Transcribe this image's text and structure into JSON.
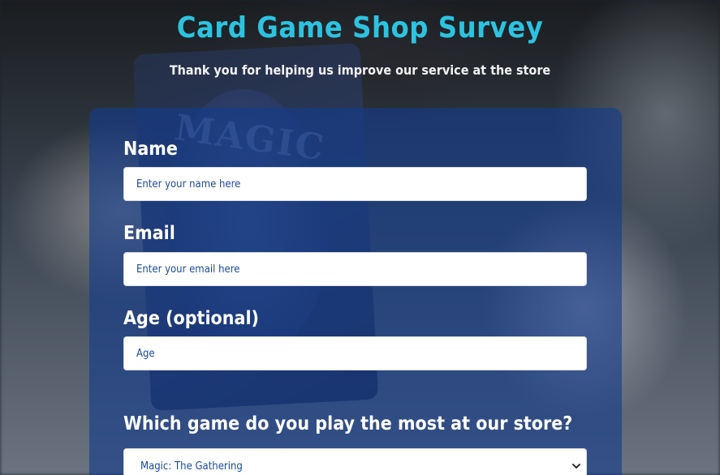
{
  "header": {
    "title": "Card Game Shop Survey",
    "subtitle": "Thank you for helping us improve our service at the store"
  },
  "form": {
    "name": {
      "label": "Name",
      "placeholder": "Enter your name here",
      "value": ""
    },
    "email": {
      "label": "Email",
      "placeholder": "Enter your email here",
      "value": ""
    },
    "age": {
      "label": "Age (optional)",
      "placeholder": "Age",
      "value": ""
    },
    "game": {
      "label": "Which game do you play the most at our store?",
      "selected": "Magic: The Gathering"
    }
  },
  "colors": {
    "title": "#2cc3e0",
    "panel": "#143c8c",
    "input_text": "#1a4a9c"
  }
}
